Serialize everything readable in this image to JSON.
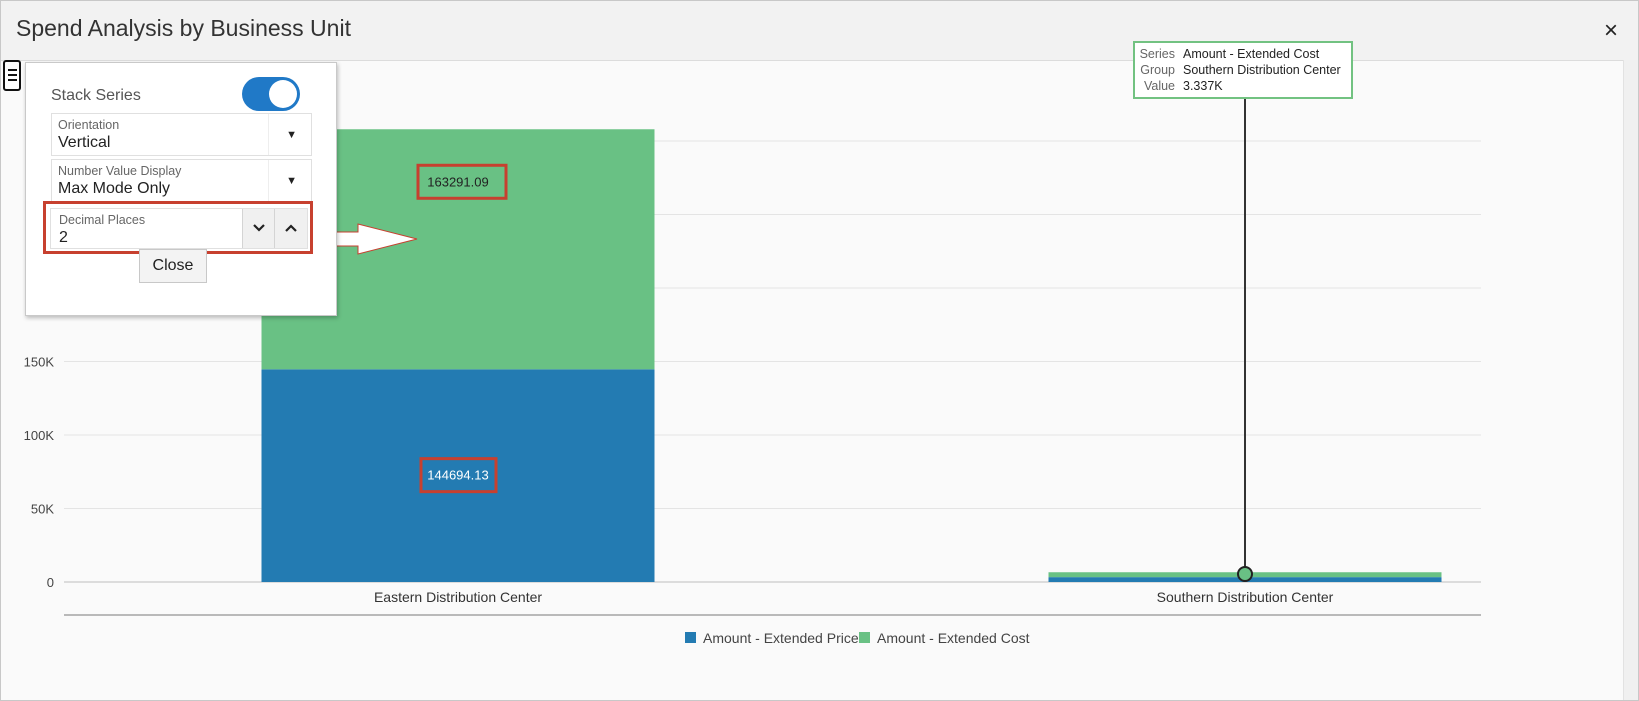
{
  "dialog": {
    "title": "Spend Analysis by Business Unit",
    "close_glyph": "×"
  },
  "panel": {
    "stack_series_label": "Stack Series",
    "stack_series_on": true,
    "orientation": {
      "label": "Orientation",
      "value": "Vertical"
    },
    "number_value_display": {
      "label": "Number Value Display",
      "value": "Max Mode Only"
    },
    "decimal_places": {
      "label": "Decimal Places",
      "value": "2"
    },
    "close_label": "Close",
    "dropdown_glyph": "▼",
    "decrement_glyph": "⌄",
    "increment_glyph": "⌃"
  },
  "tooltip": {
    "series_key": "Series",
    "series_value": "Amount - Extended Cost",
    "group_key": "Group",
    "group_value": "Southern Distribution Center",
    "value_key": "Value",
    "value_value": "3.337K"
  },
  "colors": {
    "price": "#237bb2",
    "cost": "#69c184",
    "highlight": "#c7402f",
    "toggle": "#2079c7"
  },
  "chart_data": {
    "type": "bar",
    "stacked": true,
    "categories": [
      "Eastern Distribution Center",
      "Southern Distribution Center"
    ],
    "series": [
      {
        "name": "Amount - Extended Price",
        "values": [
          144694.13,
          3300
        ],
        "color": "#237bb2"
      },
      {
        "name": "Amount - Extended Cost",
        "values": [
          163291.09,
          3337
        ],
        "color": "#69c184"
      }
    ],
    "data_labels": [
      "144694.13",
      "163291.09"
    ],
    "yticks": [
      0,
      50000,
      100000,
      150000
    ],
    "ytick_labels": [
      "0",
      "50K",
      "100K",
      "150K"
    ],
    "ylim": [
      0,
      325000
    ],
    "grid": true,
    "legend_position": "bottom"
  }
}
